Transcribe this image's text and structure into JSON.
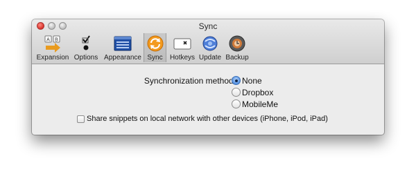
{
  "window": {
    "title": "Sync"
  },
  "toolbar": {
    "items": [
      {
        "label": "Expansion",
        "icon": "expansion-keys-arrow-icon"
      },
      {
        "label": "Options",
        "icon": "options-checkmark-radio-icon"
      },
      {
        "label": "Appearance",
        "icon": "appearance-window-icon"
      },
      {
        "label": "Sync",
        "icon": "sync-arrows-icon",
        "selected": true
      },
      {
        "label": "Hotkeys",
        "icon": "hotkeys-key-icon"
      },
      {
        "label": "Update",
        "icon": "update-globe-icon"
      },
      {
        "label": "Backup",
        "icon": "backup-time-machine-icon"
      }
    ]
  },
  "sync": {
    "method_label": "Synchronization method:",
    "options": [
      "None",
      "Dropbox",
      "MobileMe"
    ],
    "selected": "None",
    "share_label": "Share snippets on local network with other devices (iPhone, iPod, iPad)",
    "share_checked": false
  },
  "colors": {
    "selected_radio": "#5a95e3",
    "sync_icon": "#f39a1e"
  }
}
